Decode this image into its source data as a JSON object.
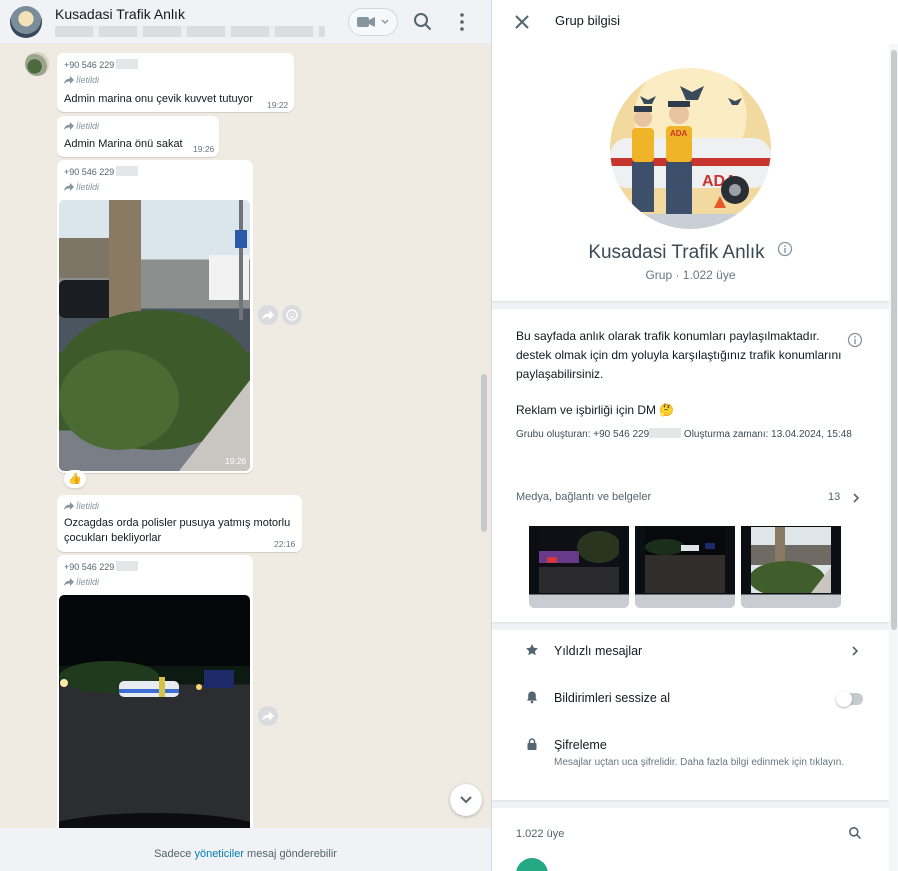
{
  "chat": {
    "title": "Kusadasi Trafik Anlık",
    "footer_prefix": "Sadece ",
    "footer_link": "yöneticiler",
    "footer_suffix": " mesaj gönderebilir"
  },
  "messages": [
    {
      "sender": "+90 546 229",
      "forwarded": "İletildi",
      "text": "Admin marina onu çevik kuvvet tutuyor",
      "time": "19:22"
    },
    {
      "forwarded": "İletildi",
      "text": "Admin Marina önü sakat",
      "time": "19:26"
    },
    {
      "sender": "+90 546 229",
      "forwarded": "İletildi",
      "image_time": "19:26",
      "reaction": "👍"
    },
    {
      "forwarded": "İletildi",
      "text_line1": "Ozcagdas orda polisler pusuya yatmış motorlu",
      "text_line2": "çocukları bekliyorlar",
      "time": "22:16"
    },
    {
      "sender": "+90 546 229",
      "forwarded": "İletildi"
    }
  ],
  "info": {
    "title": "Grup bilgisi",
    "group_name": "Kusadasi Trafik Anlık",
    "group_sub": "Grup · 1.022 üye",
    "photo_badge": "ADA",
    "photo_car_text": "ADA",
    "description": "Bu sayfada anlık olarak trafik konumları paylaşılmaktadır. destek olmak için dm yoluyla karşılaştığınız trafik konumlarını paylaşabilirsiniz.",
    "ad_text": "Reklam ve işbirliği için DM 🤔",
    "created_prefix": "Grubu oluşturan: +90 546 229",
    "created_suffix": " Oluşturma zamanı: 13.04.2024, 15:48",
    "media_label": "Medya, bağlantı ve belgeler",
    "media_count": "13",
    "starred": "Yıldızlı mesajlar",
    "mute": "Bildirimleri sessize al",
    "mute_on": false,
    "encryption": "Şifreleme",
    "encryption_desc": "Mesajlar uçtan uca şifrelidir. Daha fazla bilgi edinmek için tıklayın.",
    "members_label": "1.022 üye"
  },
  "colors": {
    "link": "#027eb5",
    "chat_bg": "#efeae2",
    "member_avatar": "#25a884"
  },
  "icons": [
    "video-call-icon",
    "search-icon",
    "menu-icon",
    "forward-icon",
    "emoji-icon",
    "chevron-down-icon",
    "close-icon",
    "info-icon",
    "star-icon",
    "bell-icon",
    "lock-icon",
    "chevron-right-icon"
  ]
}
